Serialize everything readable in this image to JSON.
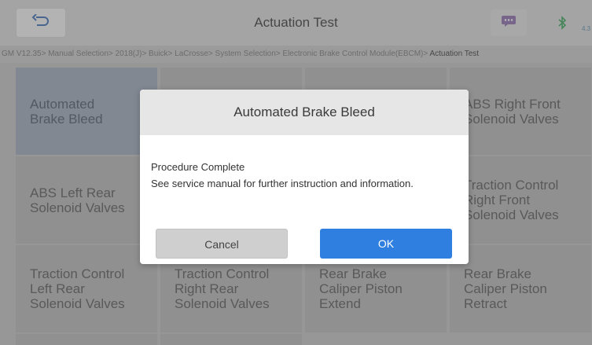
{
  "header": {
    "title": "Actuation Test",
    "battery_label": "4.3"
  },
  "breadcrumb": {
    "path": "GM V12.35> Manual Selection> 2018(J)> Buick> LaCrosse> System Selection> Electronic Brake Control Module(EBCM)> ",
    "current": "Actuation Test"
  },
  "tiles": [
    {
      "label": "Automated\nBrake Bleed"
    },
    {
      "label": ""
    },
    {
      "label": ""
    },
    {
      "label": "ABS Right Front\nSolenoid Valves"
    },
    {
      "label": "ABS Left Rear\nSolenoid Valves"
    },
    {
      "label": ""
    },
    {
      "label": ""
    },
    {
      "label": "Traction Control\nRight Front\nSolenoid Valves"
    },
    {
      "label": "Traction Control\nLeft Rear\nSolenoid Valves"
    },
    {
      "label": "Traction Control\nRight Rear\nSolenoid Valves"
    },
    {
      "label": "Rear Brake\nCaliper Piston\nExtend"
    },
    {
      "label": "Rear Brake\nCaliper Piston\nRetract"
    }
  ],
  "dialog": {
    "title": "Automated Brake Bleed",
    "message_line1": "Procedure Complete",
    "message_line2": "See service manual for further instruction and information.",
    "cancel_label": "Cancel",
    "ok_label": "OK"
  },
  "colors": {
    "ok_button": "#2f7fe0",
    "selected_tile": "#9aa5b5"
  }
}
